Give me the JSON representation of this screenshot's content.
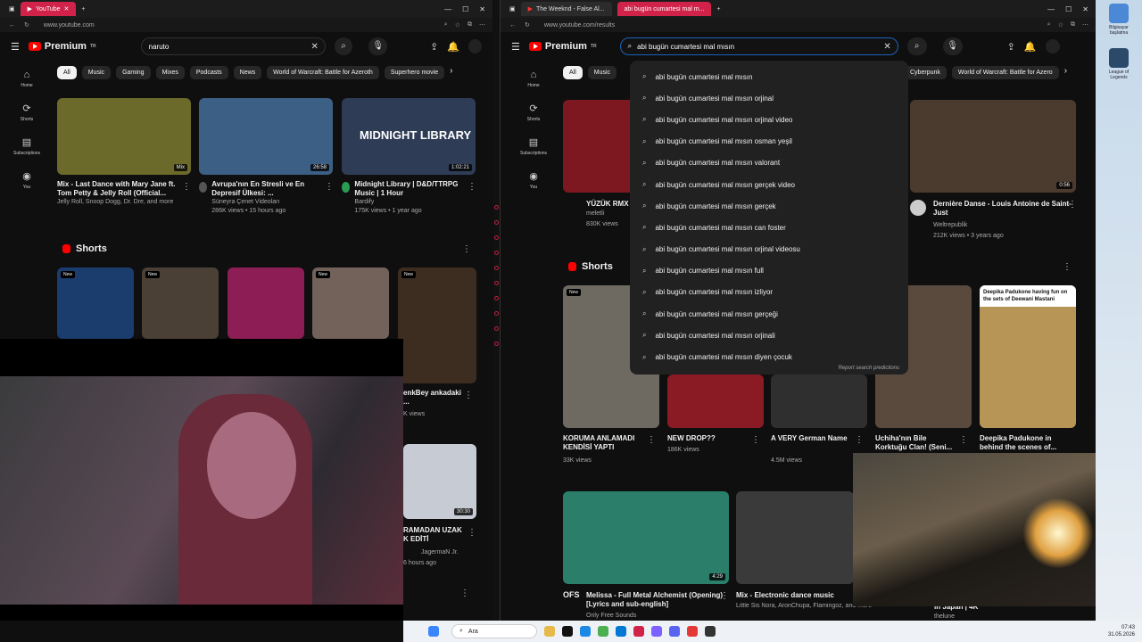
{
  "left": {
    "tabs": [
      {
        "label": "YouTube",
        "active": true
      }
    ],
    "url": "www.youtube.com",
    "logo": "Premium",
    "logo_sup": "TR",
    "search_value": "naruto",
    "chips": [
      "All",
      "Music",
      "Gaming",
      "Mixes",
      "Podcasts",
      "News",
      "World of Warcraft: Battle for Azeroth",
      "Superhero movie"
    ],
    "sidebar": [
      {
        "icon": "home-icon",
        "label": "Home"
      },
      {
        "icon": "shorts-icon",
        "label": "Shorts"
      },
      {
        "icon": "subscriptions-icon",
        "label": "Subscriptions"
      },
      {
        "icon": "you-icon",
        "label": "You"
      }
    ],
    "videos": [
      {
        "title": "Mix - Last Dance with Mary Jane ft. Tom Petty & Jelly Roll (Official...",
        "channel": "Jelly Roll, Snoop Dogg, Dr. Dre, and more",
        "meta": "",
        "badge": "Mix",
        "color": "#6b6a2a"
      },
      {
        "title": "Avrupa'nın En Stresli ve En Depresif Ülkesi: ...",
        "channel": "Süneyra Çenet Videoları",
        "meta": "286K views • 15 hours ago",
        "badge": "26:58",
        "color": "#3c5f85"
      },
      {
        "title": "Midnight Library | D&D/TTRPG Music | 1 Hour",
        "channel": "Bardify",
        "meta": "175K views • 1 year ago",
        "badge": "1:02:21",
        "color": "#2e3d55",
        "overlay_text": "MIDNIGHT LIBRARY"
      }
    ],
    "shorts_label": "Shorts",
    "shorts": [
      {
        "new": "New",
        "color": "#1b3d6e"
      },
      {
        "new": "New",
        "color": "#4b4036"
      },
      {
        "new": "",
        "color": "#8c1e55"
      },
      {
        "new": "New",
        "color": "#72625a"
      },
      {
        "new": "New",
        "color": "#3d2c20"
      }
    ],
    "short_partial": {
      "title": "enkBey ankadaki ...",
      "meta": "K views"
    },
    "short_partial2": {
      "title": "RAMADAN UZAK K EDİTİ",
      "meta": "JagermaN Jr.",
      "meta2": "6 hours ago",
      "badge": "30:30"
    }
  },
  "right": {
    "tabs": [
      {
        "label": "The Weeknd - False Al..."
      },
      {
        "label": "abi bugün cumartesi mal m...",
        "active": true
      }
    ],
    "url": "www.youtube.com/results",
    "logo": "Premium",
    "logo_sup": "TR",
    "search_value": "abi bugün cumartesi mal mısın",
    "chips_visible": [
      "All",
      "Music",
      "Cyberpunk",
      "World of Warcraft: Battle for Azero"
    ],
    "sidebar": [
      {
        "icon": "home-icon",
        "label": "Home"
      },
      {
        "icon": "shorts-icon",
        "label": "Shorts"
      },
      {
        "icon": "subscriptions-icon",
        "label": "Subscriptions"
      },
      {
        "icon": "you-icon",
        "label": "You"
      }
    ],
    "suggestions": [
      "abi bugün cumartesi mal mısın",
      "abi bugün cumartesi mal mısın orjinal",
      "abi bugün cumartesi mal mısın orjinal video",
      "abi bugün cumartesi mal mısın osman yeşil",
      "abi bugün cumartesi mal mısın valorant",
      "abi bugün cumartesi mal mısın gerçek video",
      "abi bugün cumartesi mal mısın gerçek",
      "abi bugün cumartesi mal mısın can foster",
      "abi bugün cumartesi mal mısın orjinal videosu",
      "abi bugün cumartesi mal mısın full",
      "abi bugün cumartesi mal mısın izliyor",
      "abi bugün cumartesi mal mısın gerçeği",
      "abi bugün cumartesi mal mısın orjinali",
      "abi bugün cumartesi mal mısın diyen çocuk"
    ],
    "report": "Report search predictions",
    "top_video_left": {
      "title": "YÜZÜK RMX",
      "channel": "meletli",
      "meta": "830K views"
    },
    "top_video_right": {
      "title": "Dernière Danse - Louis Antoine de Saint-Just",
      "channel": "Weltrepublik",
      "meta": "212K views • 3 years ago",
      "badge": "0:56"
    },
    "shorts_label": "Shorts",
    "shorts": [
      {
        "title": "KORUMA ANLAMADI KENDİSİ YAPTI",
        "meta": "33K views",
        "new": "New",
        "color": "#6e6a62"
      },
      {
        "title": "NEW DROP??",
        "meta": "186K views",
        "color": "#8a1b25"
      },
      {
        "title": "A VERY German Name",
        "meta": "4.5M views",
        "color": "#2f2f2f"
      },
      {
        "title": "Uchiha'nın Bile Korktuğu Clan! (Seni...",
        "meta": "",
        "color": "#5a4a3e"
      },
      {
        "title": "Deepika Padukone in behind the scenes of...",
        "meta": "",
        "color": "#b69557",
        "overlay": "Deepika Padukone having fun on the sets of Deewani Mastani"
      }
    ],
    "bottom_videos": [
      {
        "title": "Melissa - Full Metal Alchemist (Opening) [Lyrics and sub-english]",
        "channel": "Only Free Sounds",
        "badge": "4:29",
        "color": "#2a7e6a"
      },
      {
        "title": "Mix - Electronic dance music",
        "channel": "Little Sis Nora, AronChupa, Flamingoz, and more",
        "badge": "",
        "color": "#3a3a3a"
      }
    ],
    "bottom_partial": {
      "title": "in Japan | 4K",
      "channel": "thelune"
    }
  },
  "desktop_icons": [
    {
      "label": "Bilgisayar başlatma",
      "color": "#4b89d6"
    },
    {
      "label": "League of Legends",
      "color": "#2b4a6a"
    }
  ],
  "taskbar": {
    "search": "Ara",
    "time": "07:43",
    "date": "31.05.2026"
  }
}
